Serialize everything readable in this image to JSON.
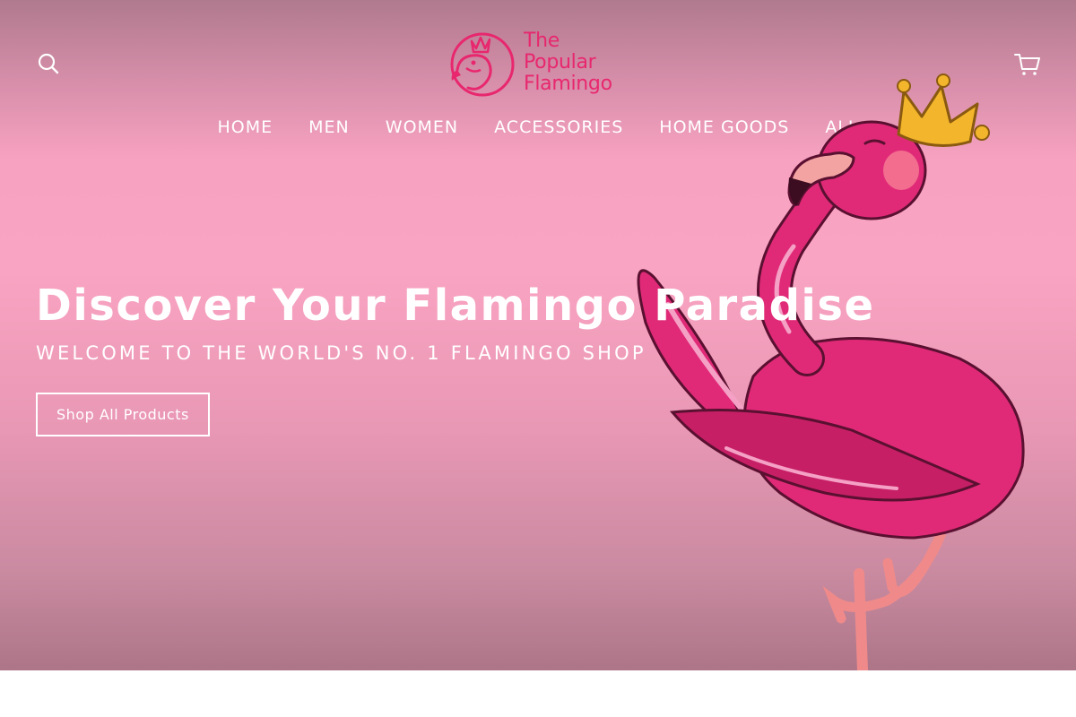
{
  "header": {
    "logo": {
      "line1": "The",
      "line2": "Popular",
      "line3": "Flamingo"
    },
    "search_icon": "search-icon",
    "cart_icon": "cart-icon"
  },
  "nav": {
    "items": [
      {
        "label": "HOME"
      },
      {
        "label": "MEN"
      },
      {
        "label": "WOMEN"
      },
      {
        "label": "ACCESSORIES"
      },
      {
        "label": "HOME GOODS"
      },
      {
        "label": "ALL"
      }
    ]
  },
  "hero": {
    "title": "Discover Your Flamingo Paradise",
    "subtitle": "WELCOME TO THE WORLD'S NO. 1 FLAMINGO SHOP",
    "cta_label": "Shop All Products",
    "illustration": "crowned-flamingo-illustration"
  },
  "colors": {
    "brand_pink": "#e8276e",
    "hero_pink": "#f9a4c2",
    "flamingo_pink": "#e02a78",
    "crown_gold": "#f3b52b"
  }
}
